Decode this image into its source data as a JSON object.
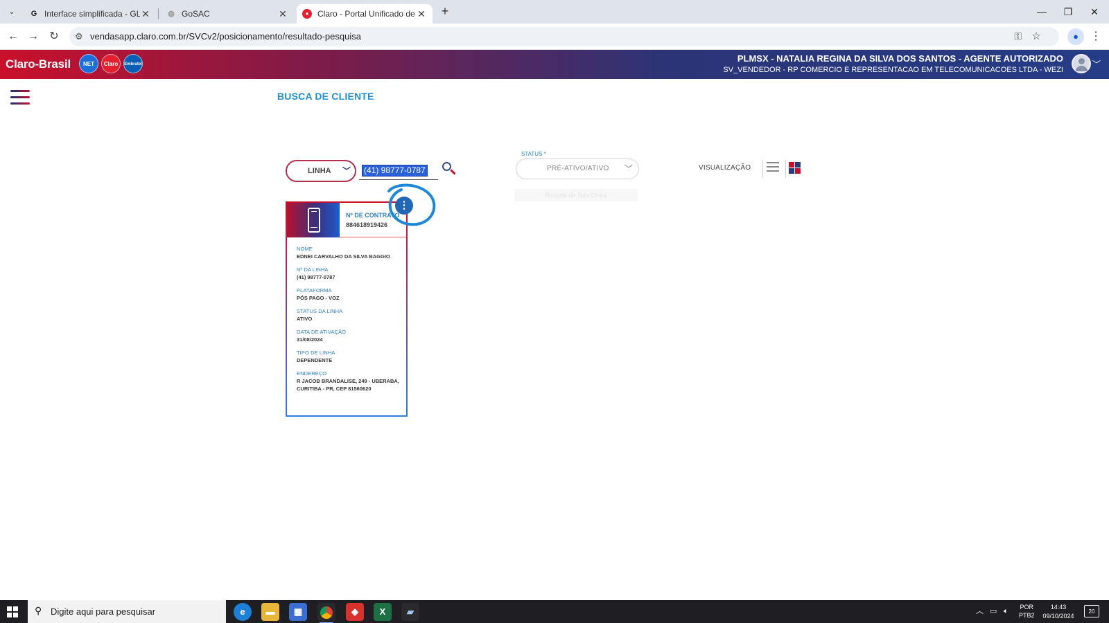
{
  "browser": {
    "tabs": [
      {
        "title": "Interface simplificada - GLPI",
        "icon": "glpi-icon"
      },
      {
        "title": "GoSAC",
        "icon": "globe-icon"
      },
      {
        "title": "Claro - Portal Unificado de Vend",
        "icon": "claro-icon"
      }
    ],
    "url": "vendasapp.claro.com.br/SVCv2/posicionamento/resultado-pesquisa"
  },
  "header": {
    "logo_text": "Claro-Brasil",
    "brands": [
      "NET",
      "Claro",
      "Embratel"
    ],
    "user_name": "PLMSX - NATALIA REGINA DA SILVA DOS SANTOS - AGENTE AUTORIZADO",
    "user_company": "SV_VENDEDOR - RP COMERCIO E REPRESENTACAO EM TELECOMUNICACOES LTDA - WEZI"
  },
  "search": {
    "title": "BUSCA DE CLIENTE",
    "type_value": "LINHA",
    "query_value": "(41) 98777-0787",
    "status_label": "STATUS *",
    "status_value": "PRÉ-ATIVO/ATIVO",
    "status_ghost": "Recorte de Tela Cheia",
    "view_label": "VISUALIZAÇÃO"
  },
  "card": {
    "contract_label": "Nº DE CONTRATO",
    "contract_value": "884618919426",
    "fields": [
      {
        "label": "NOME",
        "value": "EDNEI CARVALHO DA SILVA BAGGIO"
      },
      {
        "label": "Nº DA LINHA",
        "value": "(41) 98777-0787"
      },
      {
        "label": "PLATAFORMA",
        "value": "PÓS PAGO - VOZ"
      },
      {
        "label": "STATUS DA LINHA",
        "value": "ATIVO"
      },
      {
        "label": "DATA DE ATIVAÇÃO",
        "value": "31/08/2024"
      },
      {
        "label": "TIPO DE LINHA",
        "value": "DEPENDENTE"
      },
      {
        "label": "ENDEREÇO",
        "value": "R JACOB BRANDALISE, 249 - UBERABA, CURITIBA - PR, CEP 81560620"
      }
    ]
  },
  "taskbar": {
    "search_placeholder": "Digite aqui para pesquisar",
    "lang_line1": "POR",
    "lang_line2": "PTB2",
    "time": "14:43",
    "date": "09/10/2024",
    "notifications": "20"
  },
  "colors": {
    "claro_red": "#c8102e",
    "claro_blue": "#253c86",
    "accent_blue": "#1d8fd1",
    "grid_red": "#c8102e",
    "grid_navy": "#2c3a7a"
  }
}
